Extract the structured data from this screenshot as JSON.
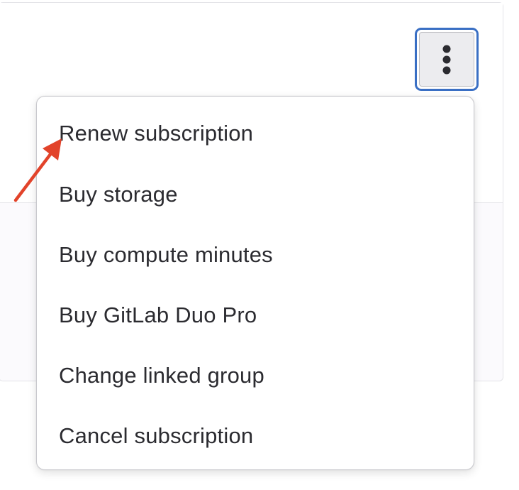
{
  "actions_menu": {
    "toggle_icon": "more-actions-vertical-icon",
    "items": [
      {
        "label": "Renew subscription"
      },
      {
        "label": "Buy storage"
      },
      {
        "label": "Buy compute minutes"
      },
      {
        "label": "Buy GitLab Duo Pro"
      },
      {
        "label": "Change linked group"
      },
      {
        "label": "Cancel subscription"
      }
    ]
  },
  "annotation": {
    "arrow_icon": "pointer-arrow-icon",
    "color": "#e2432a"
  },
  "colors": {
    "focus_ring": "#3a6fc4",
    "button_background": "#ececef",
    "text": "#2b2b30"
  }
}
